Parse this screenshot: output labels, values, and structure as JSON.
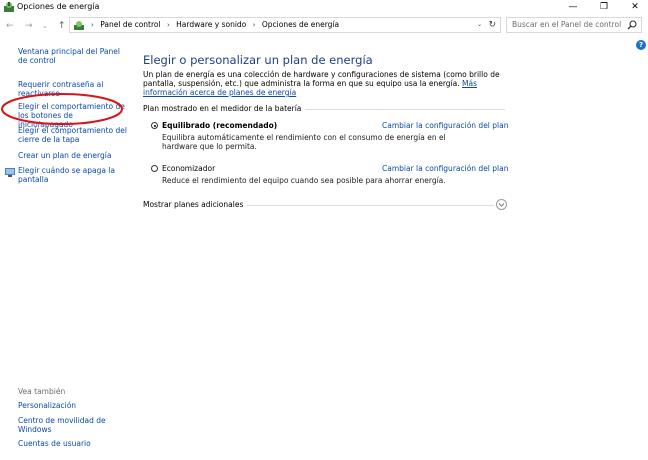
{
  "window": {
    "title": "Opciones de energía",
    "controls": {
      "minimize": "—",
      "maximize": "❐",
      "close": "✕"
    }
  },
  "navigation": {
    "back": "←",
    "forward": "→",
    "history": "⌄",
    "up": "↑",
    "breadcrumbs": [
      "Panel de control",
      "Hardware y sonido",
      "Opciones de energía"
    ],
    "separator": "›",
    "dropdown": "⌄",
    "refresh": "↻",
    "search_placeholder": "Buscar en el Panel de control"
  },
  "sidebar": {
    "items": [
      "Ventana principal del Panel de control",
      "Requerir contraseña al reactivarse",
      "Elegir el comportamiento de los botones de inicio/apagado",
      "Elegir el comportamiento del cierre de la tapa",
      "Crear un plan de energía",
      "Elegir cuándo se apaga la pantalla"
    ],
    "see_also_title": "Vea también",
    "see_also": [
      "Personalización",
      "Centro de movilidad de Windows",
      "Cuentas de usuario"
    ]
  },
  "main": {
    "heading": "Elegir o personalizar un plan de energía",
    "intro": "Un plan de energía es una colección de hardware y configuraciones de sistema (como brillo de pantalla, suspensión, etc.) que administra la forma en que su equipo usa la energía. ",
    "intro_link": "Más información acerca de planes de energía",
    "group_label": "Plan mostrado en el medidor de la batería",
    "plans": [
      {
        "name": "Equilibrado (recomendado)",
        "description": "Equilibra automáticamente el rendimiento con el consumo de energía en el hardware que lo permita.",
        "link": "Cambiar la configuración del plan",
        "selected": true
      },
      {
        "name": "Economizador",
        "description": "Reduce el rendimiento del equipo cuando sea posible para ahorrar energía.",
        "link": "Cambiar la configuración del plan",
        "selected": false
      }
    ],
    "more_plans": "Mostrar planes adicionales"
  },
  "colors": {
    "link": "#0a4aa8",
    "heading": "#1e3f8a",
    "annotation": "#d9141b"
  }
}
